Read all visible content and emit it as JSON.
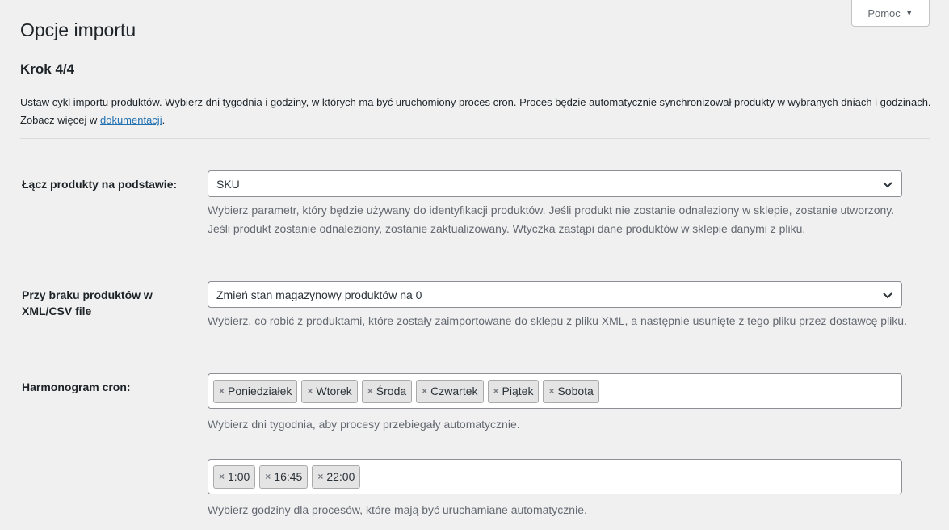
{
  "help": {
    "label": "Pomoc"
  },
  "page": {
    "title": "Opcje importu",
    "step": "Krok 4/4",
    "intro_text": "Ustaw cykl importu produktów. Wybierz dni tygodnia i godziny, w których ma być uruchomiony proces cron. Proces będzie automatycznie synchronizował produkty w wybranych dniach i godzinach. Zobacz więcej w ",
    "intro_link": "dokumentacji",
    "intro_end": "."
  },
  "fields": {
    "match": {
      "label": "Łącz produkty na podstawie:",
      "value": "SKU",
      "description": "Wybierz parametr, który będzie używany do identyfikacji produktów. Jeśli produkt nie zostanie odnaleziony w sklepie, zostanie utworzony. Jeśli produkt zostanie odnaleziony, zostanie zaktualizowany. Wtyczka zastąpi dane produktów w sklepie danymi z pliku."
    },
    "missing": {
      "label": "Przy braku produktów w XML/CSV file",
      "value": "Zmień stan magazynowy produktów na 0",
      "description": "Wybierz, co robić z produktami, które zostały zaimportowane do sklepu z pliku XML, a następnie usunięte z tego pliku przez dostawcę pliku."
    },
    "cron": {
      "label": "Harmonogram cron:",
      "days": [
        "Poniedziałek",
        "Wtorek",
        "Środa",
        "Czwartek",
        "Piątek",
        "Sobota"
      ],
      "days_description": "Wybierz dni tygodnia, aby procesy przebiegały automatycznie.",
      "hours": [
        "1:00",
        "16:45",
        "22:00"
      ],
      "hours_description": "Wybierz godziny dla procesów, które mają być uruchamiane automatycznie."
    }
  }
}
